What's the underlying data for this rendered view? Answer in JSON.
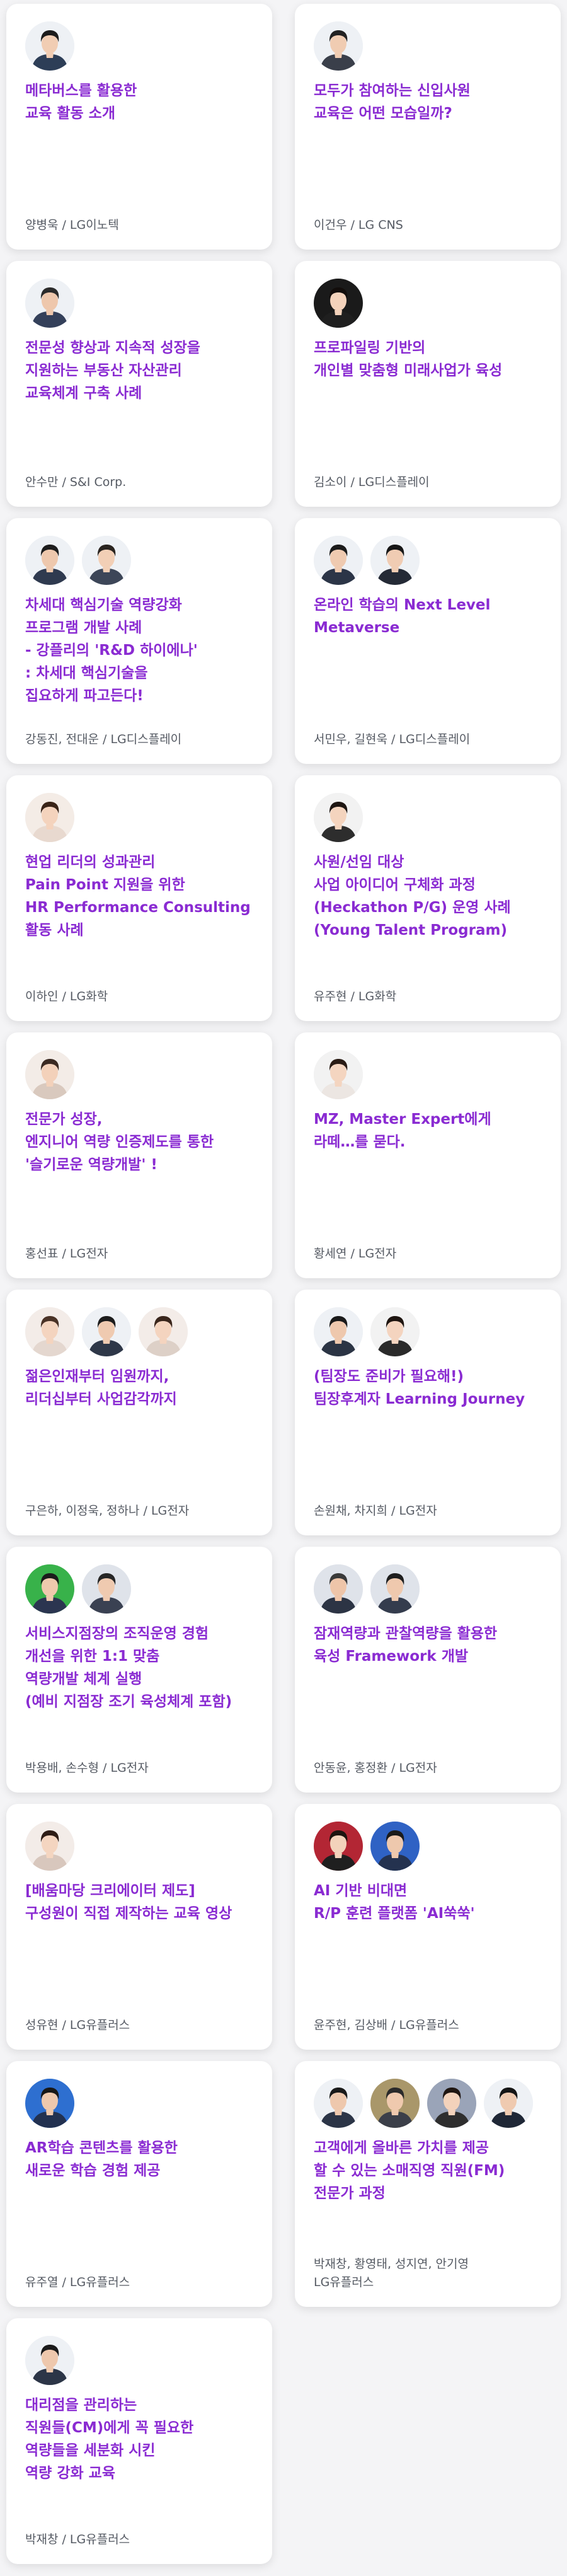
{
  "cards": [
    {
      "title": "메타버스를 활용한\n교육 활동 소개",
      "author": "양병욱 / LG이노텍",
      "avatars": [
        {
          "bg": "#eef1f5",
          "skin": "#f1cdb3",
          "hair": "#1c1c1c",
          "shirt": "#2d3e57"
        }
      ]
    },
    {
      "title": "모두가 참여하는 신입사원\n교육은 어떤 모습일까?",
      "author": "이건우 / LG CNS",
      "avatars": [
        {
          "bg": "#eef1f5",
          "skin": "#f0ccb2",
          "hair": "#222222",
          "shirt": "#3a3f4a"
        }
      ]
    },
    {
      "title": "전문성 향상과 지속적 성장을\n지원하는 부동산 자산관리\n교육체계 구축 사례",
      "author": "안수만 / S&I Corp.",
      "avatars": [
        {
          "bg": "#eef1f5",
          "skin": "#eec7ac",
          "hair": "#2b2b2b",
          "shirt": "#34405a"
        }
      ]
    },
    {
      "title": "프로파일링 기반의\n개인별 맞춤형 미래사업가 육성",
      "author": "김소이 / LG디스플레이",
      "avatars": [
        {
          "bg": "#1a1a1a",
          "skin": "#f3d2bb",
          "hair": "#120d0b",
          "shirt": "#1f1f1f"
        }
      ]
    },
    {
      "title": "차세대 핵심기술 역량강화\n프로그램 개발 사례\n- 강플리의 'R&D 하이에나'\n: 차세대 핵심기술을\n집요하게 파고든다!",
      "author": "강동진, 전대운 / LG디스플레이",
      "avatars": [
        {
          "bg": "#eef1f5",
          "skin": "#eec8ad",
          "hair": "#1d1d1d",
          "shirt": "#2f3a4f"
        },
        {
          "bg": "#eef1f5",
          "skin": "#f2cfb6",
          "hair": "#2a2420",
          "shirt": "#3d4658"
        }
      ]
    },
    {
      "title": "온라인 학습의 Next Level\nMetaverse",
      "author": "서민우, 길현욱 / LG디스플레이",
      "avatars": [
        {
          "bg": "#eef1f5",
          "skin": "#efcab0",
          "hair": "#1b1b1b",
          "shirt": "#2c3547"
        },
        {
          "bg": "#eef1f5",
          "skin": "#f0ccb3",
          "hair": "#161616",
          "shirt": "#242a36"
        }
      ]
    },
    {
      "title": "현업 리더의 성과관리\nPain Point 지원을 위한\nHR Performance Consulting\n활동 사례",
      "author": "이하인 / LG화학",
      "avatars": [
        {
          "bg": "#f4ece6",
          "skin": "#f4d3bd",
          "hair": "#3a2418",
          "shirt": "#e8d9cf"
        }
      ]
    },
    {
      "title": "사원/선임 대상\n사업 아이디어 구체화 과정\n(Heckathon P/G) 운영 사례\n(Young Talent Program)",
      "author": "유주현 / LG화학",
      "avatars": [
        {
          "bg": "#f2f2f2",
          "skin": "#f4d4be",
          "hair": "#1e1612",
          "shirt": "#2d2d2d"
        }
      ]
    },
    {
      "title": "전문가 성장,\n엔지니어 역량 인증제도를 통한\n'슬기로운 역량개발' !",
      "author": "홍선표 / LG전자",
      "avatars": [
        {
          "bg": "#f3ece7",
          "skin": "#f3d1ba",
          "hair": "#3b2a22",
          "shirt": "#d9c9be"
        }
      ]
    },
    {
      "title": "MZ, Master Expert에게\n라떼…를 묻다.",
      "author": "황세연 / LG전자",
      "avatars": [
        {
          "bg": "#f2f2f2",
          "skin": "#f4d5c0",
          "hair": "#2a1c15",
          "shirt": "#ece6e2"
        }
      ]
    },
    {
      "title": "젊은인재부터 임원까지,\n리더십부터 사업감각까지",
      "author": "구은하, 이정욱, 정하나 / LG전자",
      "avatars": [
        {
          "bg": "#f3ece8",
          "skin": "#f4d4bf",
          "hair": "#4a3226",
          "shirt": "#e4d7cf"
        },
        {
          "bg": "#eef1f5",
          "skin": "#efcab0",
          "hair": "#1c1c1c",
          "shirt": "#2e3748"
        },
        {
          "bg": "#f3ece8",
          "skin": "#f4d4bf",
          "hair": "#3a261c",
          "shirt": "#ddd0c7"
        }
      ]
    },
    {
      "title": "(팀장도 준비가 필요해!)\n팀장후계자 Learning Journey",
      "author": "손원채, 차지희 / LG전자",
      "avatars": [
        {
          "bg": "#eef1f5",
          "skin": "#eec8ad",
          "hair": "#1a1a1a",
          "shirt": "#2b3444"
        },
        {
          "bg": "#f2f2f2",
          "skin": "#f4d4bf",
          "hair": "#1e1510",
          "shirt": "#2a2a2a"
        }
      ]
    },
    {
      "title": "서비스지점장의 조직운영 경험\n개선을 위한 1:1 맞춤\n역량개발 체계 실행\n(예비 지점장 조기 육성체계 포함)",
      "author": "박용배, 손수형 / LG전자",
      "avatars": [
        {
          "bg": "#38b24a",
          "skin": "#efc9ad",
          "hair": "#1b1b1b",
          "shirt": "#2b3550"
        },
        {
          "bg": "#dfe3ea",
          "skin": "#efcab0",
          "hair": "#262626",
          "shirt": "#3a4152"
        }
      ]
    },
    {
      "title": "잠재역량과 관찰역량을 활용한\n육성 Framework 개발",
      "author": "안동윤, 홍정환 / LG전자",
      "avatars": [
        {
          "bg": "#dfe3ea",
          "skin": "#eec5a9",
          "hair": "#3a3a3a",
          "shirt": "#2c3444"
        },
        {
          "bg": "#dfe3ea",
          "skin": "#efc9ae",
          "hair": "#1e1e1e",
          "shirt": "#343c4d"
        }
      ]
    },
    {
      "title": "[배움마당 크리에이터 제도]\n구성원이 직접 제작하는 교육 영상",
      "author": "성유현 / LG유플러스",
      "avatars": [
        {
          "bg": "#f3ece8",
          "skin": "#f4d5c0",
          "hair": "#2e1d16",
          "shirt": "#d8c7bd"
        }
      ]
    },
    {
      "title": "AI 기반 비대면\nR/P 훈련 플랫폼 'AI쑥쑥'",
      "author": "윤주현, 김상배 / LG유플러스",
      "avatars": [
        {
          "bg": "#b32634",
          "skin": "#f3d2bb",
          "hair": "#1d1410",
          "shirt": "#1f1f1f"
        },
        {
          "bg": "#2f62c4",
          "skin": "#eec8ad",
          "hair": "#1b1b1b",
          "shirt": "#24324f"
        }
      ]
    },
    {
      "title": "AR학습 콘텐츠를 활용한\n새로운 학습 경험 제공",
      "author": "유주열 / LG유플러스",
      "avatars": [
        {
          "bg": "#2e6fd0",
          "skin": "#eec8ad",
          "hair": "#181818",
          "shirt": "#223150"
        }
      ]
    },
    {
      "title": "고객에게 올바른 가치를 제공\n할 수 있는 소매직영 직원(FM)\n전문가 과정",
      "author": "박재창, 황영태, 성지연, 안기영\nLG유플러스",
      "avatars": [
        {
          "bg": "#eef1f5",
          "skin": "#eec8ad",
          "hair": "#1a1a1a",
          "shirt": "#2c3547"
        },
        {
          "bg": "#a9976a",
          "skin": "#efc9ae",
          "hair": "#2a2a2a",
          "shirt": "#3b3f49"
        },
        {
          "bg": "#9aa4b8",
          "skin": "#f3d2bb",
          "hair": "#1f1612",
          "shirt": "#2e2e2e"
        },
        {
          "bg": "#eef1f5",
          "skin": "#efcab0",
          "hair": "#161616",
          "shirt": "#1f2736"
        }
      ]
    },
    {
      "title": "대리점을 관리하는\n직원들(CM)에게 꼭 필요한\n역량들을 세분화 시킨\n역량 강화 교육",
      "author": "박재창 / LG유플러스",
      "avatars": [
        {
          "bg": "#eef1f5",
          "skin": "#eec8ad",
          "hair": "#1a1a1a",
          "shirt": "#2c3547"
        }
      ]
    }
  ]
}
